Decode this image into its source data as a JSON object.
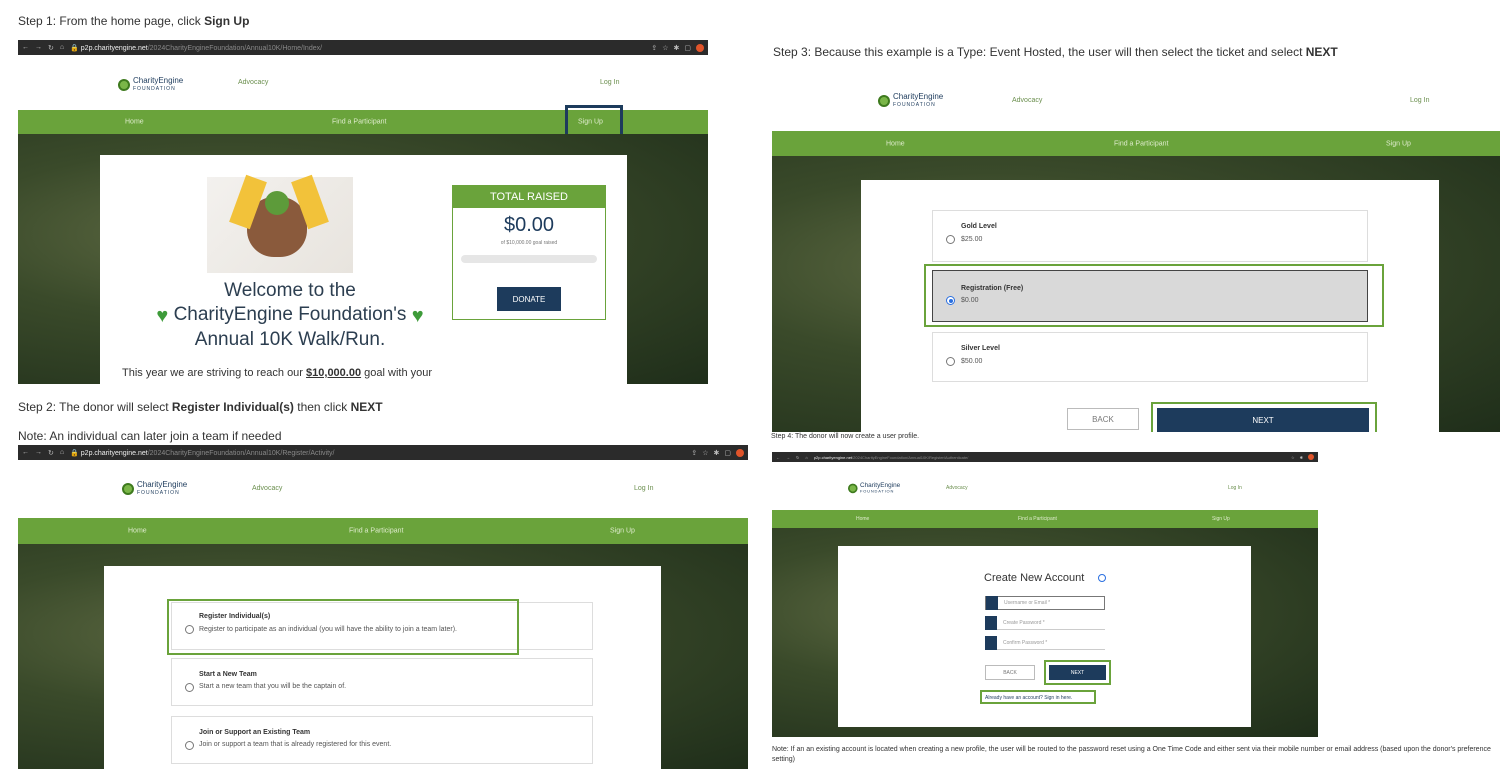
{
  "captions": {
    "step1_prefix": "Step 1: From the home page, click ",
    "step1_bold": "Sign Up",
    "step2_prefix": "Step 2: The donor will select ",
    "step2_bold": "Register Individual(s)",
    "step2_mid": " then click ",
    "step2_bold2": "NEXT",
    "step2_note": "Note: An individual can later join a team if needed",
    "step3_prefix": "Step 3: Because this example is a Type: Event Hosted, the user will then select the ticket and select ",
    "step3_bold": "NEXT",
    "step4": "Step 4: The donor will now create a user profile.",
    "bottom_note": "Note: If an an existing account is located when creating a new profile, the user will be routed to the password reset using a One Time Code and either sent via their mobile number or email address (based upon the donor's preference setting)"
  },
  "browser": {
    "url1_host": "p2p.charityengine.net",
    "url1_path": "/2024CharityEngineFoundation/Annual10K/Home/Index/",
    "url2_host": "p2p.charityengine.net",
    "url2_path": "/2024CharityEngineFoundation/Annual10K/Register/Activity/",
    "url4_host": "p2p.charityengine.net",
    "url4_path": "/2024CharityEngineFoundation/Annual10K/Register/Authenticate/"
  },
  "site": {
    "logo_name": "CharityEngine",
    "logo_sub": "FOUNDATION",
    "advocacy": "Advocacy",
    "login": "Log In",
    "nav_home": "Home",
    "nav_find": "Find a Participant",
    "nav_signup": "Sign Up"
  },
  "step1": {
    "total_raised_label": "TOTAL RAISED",
    "amount": "$0.00",
    "goal_text": "of $10,000.00 goal raised",
    "progress": 0,
    "donate": "DONATE",
    "welcome_line1": "Welcome to the",
    "welcome_line2": "CharityEngine Foundation's",
    "welcome_line3": "Annual 10K Walk/Run.",
    "intro_prefix": "This year we are striving to reach our ",
    "intro_goal": "$10,000.00",
    "intro_suffix": " goal with your"
  },
  "step2": {
    "options": [
      {
        "title": "Register Individual(s)",
        "desc": "Register to participate as an individual (you will have the ability to join a team later)."
      },
      {
        "title": "Start a New Team",
        "desc": "Start a new team that you will be the captain of."
      },
      {
        "title": "Join or Support an Existing Team",
        "desc": "Join or support a team that is already registered for this event."
      }
    ]
  },
  "step3": {
    "tickets": [
      {
        "title": "Gold Level",
        "price": "$25.00",
        "selected": false
      },
      {
        "title": "Registration (Free)",
        "price": "$0.00",
        "selected": true
      },
      {
        "title": "Silver Level",
        "price": "$50.00",
        "selected": false
      }
    ],
    "back": "BACK",
    "next": "NEXT"
  },
  "step4": {
    "title": "Create New Account",
    "username_ph": "Username or Email *",
    "password_ph": "Create Password *",
    "confirm_ph": "Confirm Password *",
    "back": "BACK",
    "next": "NEXT",
    "signin_link": "Already have an account? Sign in here."
  },
  "colors": {
    "green": "#6aa33b",
    "navy": "#1d3b5c"
  },
  "icons": [
    "back-arrow-icon",
    "forward-arrow-icon",
    "reload-icon",
    "home-icon",
    "lock-icon",
    "share-icon",
    "star-icon",
    "extension-icon",
    "heart-icon",
    "info-icon",
    "user-icon",
    "key-icon"
  ]
}
